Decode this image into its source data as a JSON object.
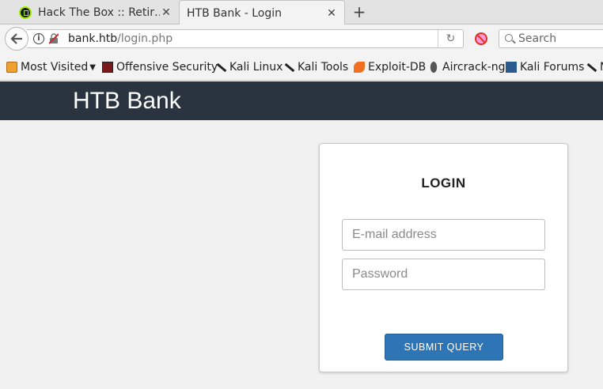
{
  "browser": {
    "tabs": [
      {
        "title": "Hack The Box :: Retir…",
        "close": "✕"
      },
      {
        "title": "HTB Bank - Login",
        "close": "✕"
      }
    ],
    "new_tab": "+",
    "url": {
      "host": "bank.htb",
      "path": "/login.php"
    },
    "reload": "↻",
    "search_placeholder": "Search",
    "bookmarks": [
      {
        "label": "Most Visited",
        "icon": "folder-icon"
      },
      {
        "label": "Offensive Security",
        "icon": "offsec-icon"
      },
      {
        "label": "Kali Linux",
        "icon": "kali-icon"
      },
      {
        "label": "Kali Tools",
        "icon": "kali-icon"
      },
      {
        "label": "Exploit-DB",
        "icon": "exploitdb-icon"
      },
      {
        "label": "Aircrack-ng",
        "icon": "aircrack-icon"
      },
      {
        "label": "Kali Forums",
        "icon": "forums-icon"
      },
      {
        "label": "N",
        "icon": "kali-icon"
      }
    ]
  },
  "page": {
    "brand": "HTB Bank",
    "login": {
      "title": "LOGIN",
      "email_placeholder": "E-mail address",
      "password_placeholder": "Password",
      "submit_label": "SUBMIT QUERY"
    }
  },
  "colors": {
    "header_bg": "#293440",
    "button_bg": "#2e75b6"
  }
}
